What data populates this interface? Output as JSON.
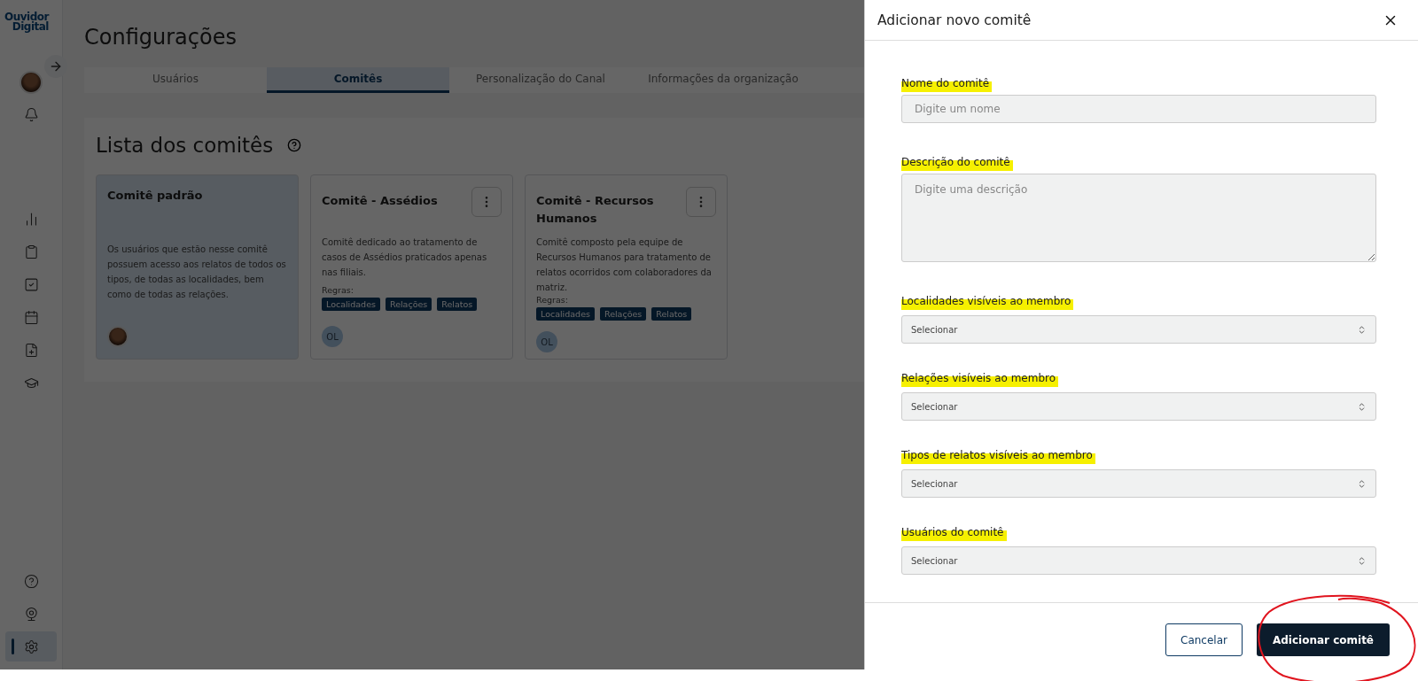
{
  "sidebar": {
    "logo": [
      "Ouvidor",
      "Digital"
    ],
    "items": [
      {
        "kind": "chart",
        "selected": false
      },
      {
        "kind": "clipboard",
        "selected": false
      },
      {
        "kind": "task",
        "selected": false
      },
      {
        "kind": "calendar",
        "selected": false
      },
      {
        "kind": "file",
        "selected": false
      },
      {
        "kind": "course",
        "selected": false
      }
    ],
    "bottom_items": [
      {
        "kind": "help",
        "selected": false
      },
      {
        "kind": "webcam",
        "selected": false
      },
      {
        "kind": "settings",
        "selected": true
      }
    ]
  },
  "page_title": "Configurações",
  "tabs": [
    {
      "label": "Usuários",
      "selected": false
    },
    {
      "label": "Comitês",
      "selected": true
    },
    {
      "label": "Personalização do Canal",
      "selected": false
    },
    {
      "label": "Informações da organização",
      "selected": false
    }
  ],
  "section_title": "Lista dos comitês",
  "committees": [
    {
      "title": "Comitê padrão",
      "description": "Os usuários que estão nesse comitê possuem acesso aos relatos de todos os tipos, de todas as localidades, bem como de todas as relações.",
      "selected": true,
      "members": [
        {
          "kind": "photo"
        }
      ]
    },
    {
      "title": "Comitê - Assédios",
      "description": "Comitê dedicado ao tratamento de casos de Assédios praticados apenas nas filiais.",
      "selected": false,
      "rules_label": "Regras:",
      "rules": [
        "Localidades",
        "Relações",
        "Relatos"
      ],
      "members": [
        {
          "kind": "initials",
          "initials": "OL"
        }
      ]
    },
    {
      "title": "Comitê - Recursos Humanos",
      "description": "Comitê composto pela equipe de Recursos Humanos para tratamento de relatos ocorridos com colaboradores da matriz.",
      "selected": false,
      "rules_label": "Regras:",
      "rules": [
        "Localidades",
        "Relações",
        "Relatos"
      ],
      "members": [
        {
          "kind": "initials",
          "initials": "OL"
        }
      ]
    }
  ],
  "drawer": {
    "title": "Adicionar novo comitê",
    "fields": [
      {
        "kind": "text",
        "label": "Nome do comitê",
        "placeholder": "Digite um nome",
        "highlighted": true
      },
      {
        "kind": "textarea",
        "label": "Descrição do comitê",
        "placeholder": "Digite uma descrição",
        "highlighted": true
      },
      {
        "kind": "select",
        "label": "Localidades visíveis ao membro",
        "value": "Selecionar",
        "highlighted": true
      },
      {
        "kind": "select",
        "label": "Relações visíveis ao membro",
        "value": "Selecionar",
        "highlighted": true
      },
      {
        "kind": "select",
        "label": "Tipos de relatos visíveis ao membro",
        "value": "Selecionar",
        "highlighted": true
      },
      {
        "kind": "select",
        "label": "Usuários do comitê",
        "value": "Selecionar",
        "highlighted": true
      }
    ],
    "cancel_button": "Cancelar",
    "submit_button": {
      "label": "Adicionar comitê",
      "circled": true
    }
  }
}
